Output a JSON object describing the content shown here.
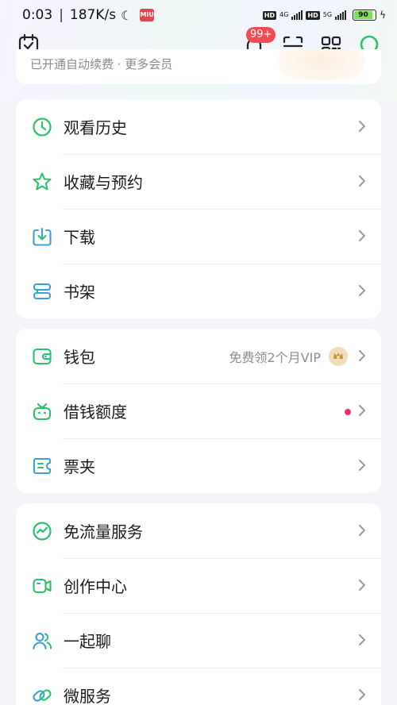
{
  "status_bar": {
    "time": "0:03",
    "speed": "187K/s",
    "mi_label": "MIUI",
    "hd1": "HD",
    "net1": "4G",
    "hd2": "HD",
    "net2": "5G",
    "battery": "90"
  },
  "toolbar": {
    "notification_badge": "99+",
    "icons": [
      "calendar-check-icon",
      "bell-icon",
      "scan-icon",
      "qr-code-icon",
      "search-icon"
    ]
  },
  "banner": {
    "text": "已开通自动续费 · 更多会员"
  },
  "groups": [
    {
      "items": [
        {
          "label": "观看历史",
          "icon": "clock-icon"
        },
        {
          "label": "收藏与预约",
          "icon": "star-icon"
        },
        {
          "label": "下载",
          "icon": "download-icon"
        },
        {
          "label": "书架",
          "icon": "bookshelf-icon"
        }
      ]
    },
    {
      "items": [
        {
          "label": "钱包",
          "icon": "wallet-icon",
          "extra": "免费领2个月VIP"
        },
        {
          "label": "借钱额度",
          "icon": "loan-icon"
        },
        {
          "label": "票夹",
          "icon": "ticket-icon"
        }
      ]
    },
    {
      "items": [
        {
          "label": "免流量服务",
          "icon": "traffic-icon"
        },
        {
          "label": "创作中心",
          "icon": "video-camera-icon"
        },
        {
          "label": "一起聊",
          "icon": "people-icon"
        },
        {
          "label": "微服务",
          "icon": "link-icon"
        }
      ]
    }
  ],
  "colors": {
    "accent": "#2bc26b",
    "accent_blue": "#3a9fe0",
    "badge_red": "#f04a55"
  }
}
